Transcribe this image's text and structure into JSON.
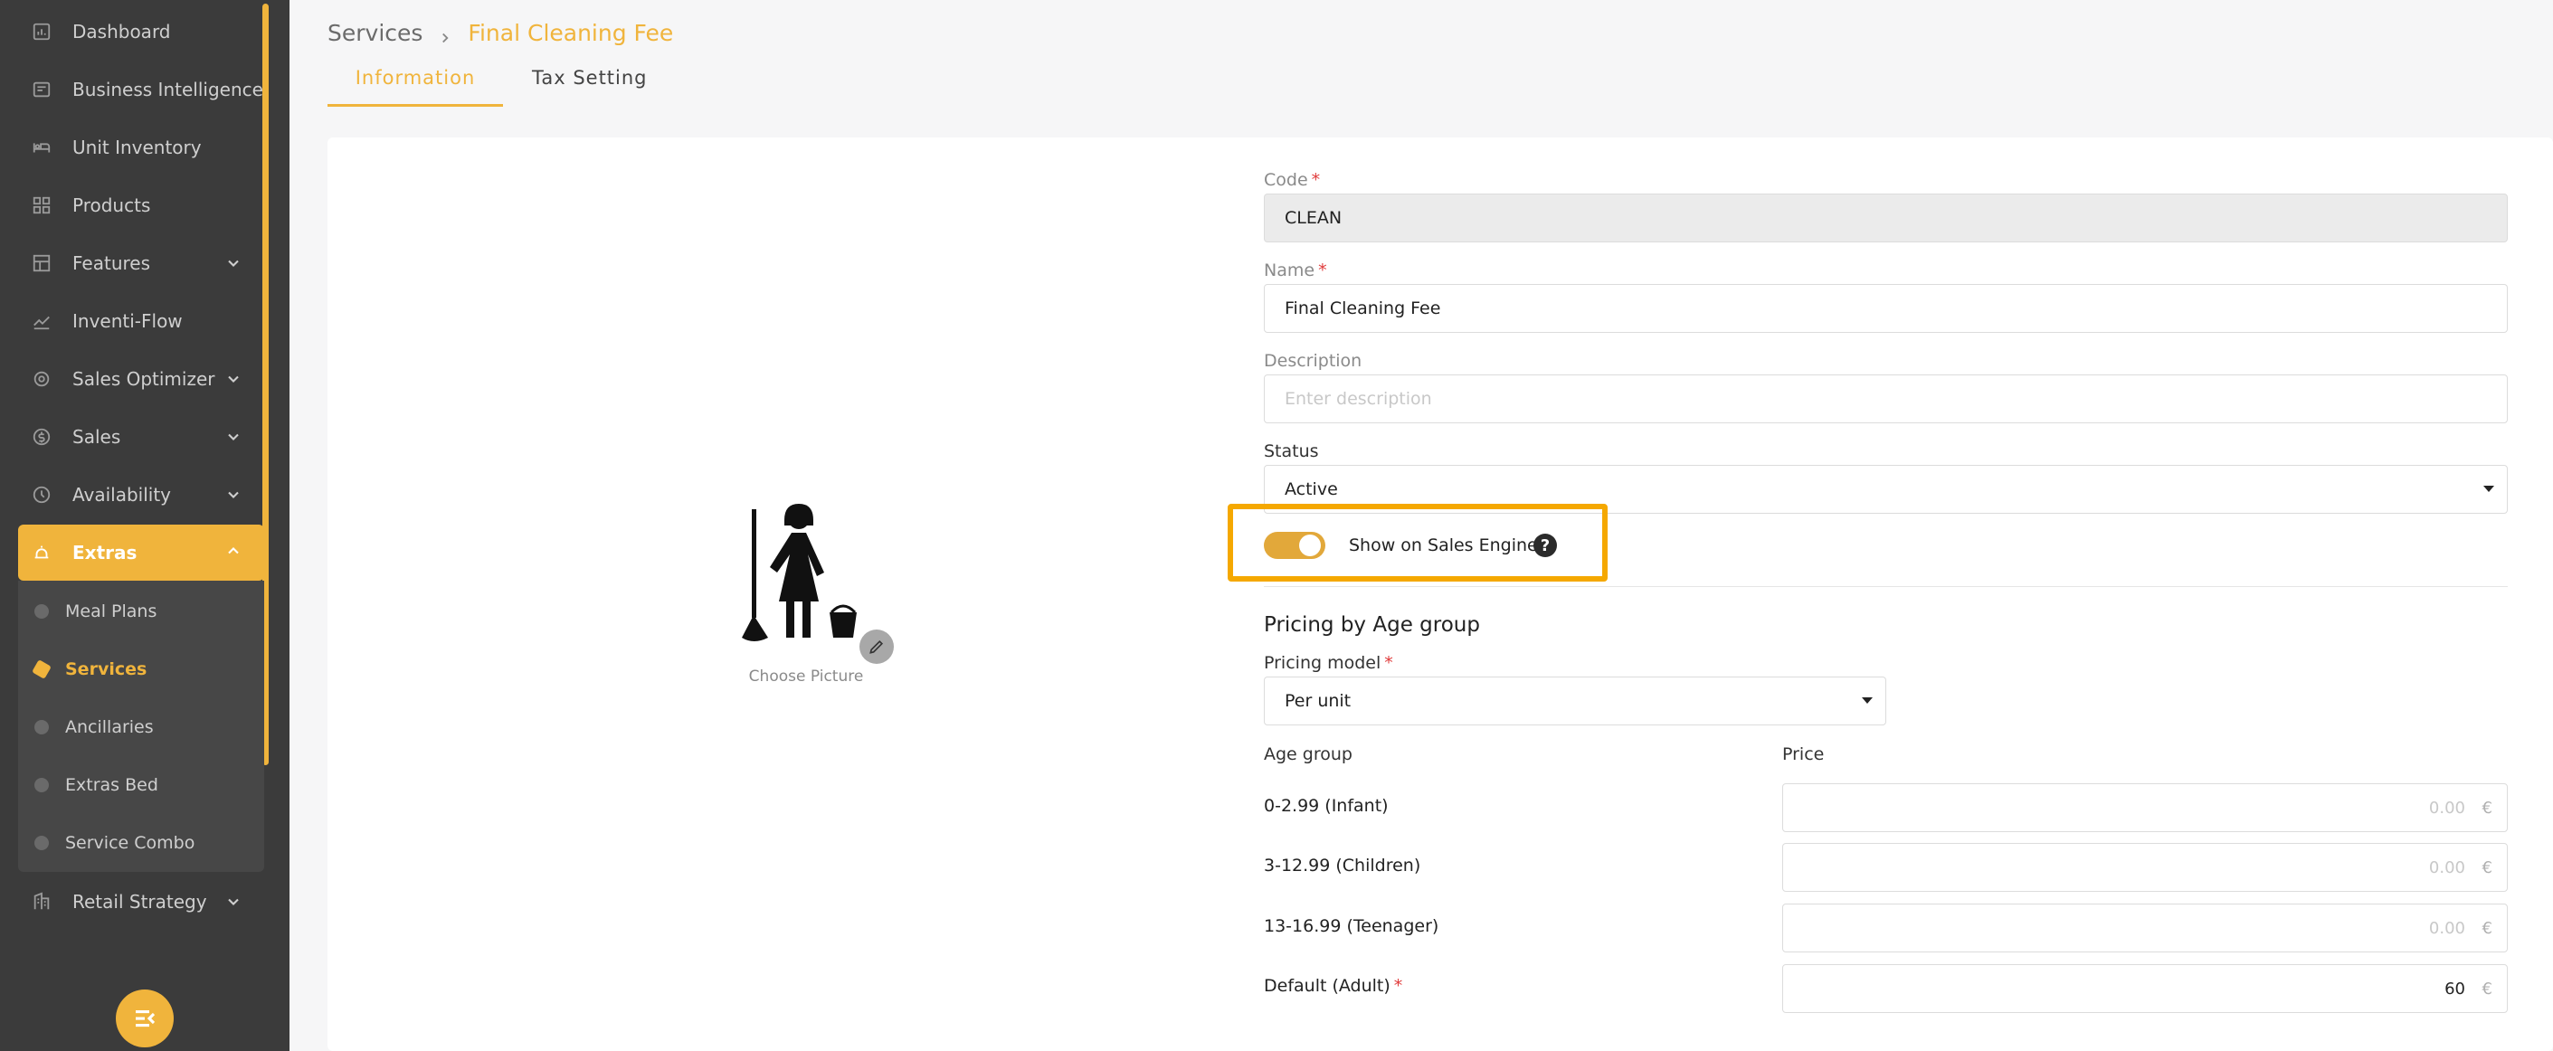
{
  "sidebar": {
    "items": [
      {
        "label": "Dashboard",
        "icon": "dashboard-icon"
      },
      {
        "label": "Business Intelligence",
        "icon": "chart-icon"
      },
      {
        "label": "Unit Inventory",
        "icon": "bed-icon"
      },
      {
        "label": "Products",
        "icon": "grid-icon"
      },
      {
        "label": "Features",
        "icon": "layout-icon"
      },
      {
        "label": "Inventi-Flow",
        "icon": "trend-icon"
      },
      {
        "label": "Sales Optimizer",
        "icon": "gear-icon"
      },
      {
        "label": "Sales",
        "icon": "dollar-icon"
      },
      {
        "label": "Availability",
        "icon": "clock-icon"
      },
      {
        "label": "Extras",
        "icon": "bell-icon"
      },
      {
        "label": "Retail Strategy",
        "icon": "building-icon"
      }
    ],
    "extras_sub": [
      "Meal Plans",
      "Services",
      "Ancillaries",
      "Extras Bed",
      "Service Combo"
    ],
    "active_sub": "Services"
  },
  "breadcrumb": {
    "root": "Services",
    "current": "Final Cleaning Fee"
  },
  "tabs": [
    "Information",
    "Tax Setting"
  ],
  "picture": {
    "label": "Choose Picture"
  },
  "form": {
    "code": {
      "label": "Code",
      "value": "CLEAN"
    },
    "name": {
      "label": "Name",
      "value": "Final Cleaning Fee"
    },
    "description": {
      "label": "Description",
      "placeholder": "Enter description"
    },
    "status": {
      "label": "Status",
      "value": "Active"
    },
    "show_on_sales_engine": {
      "label": "Show on Sales Engine",
      "on": true,
      "help": "?"
    }
  },
  "pricing": {
    "title": "Pricing by Age group",
    "model_label": "Pricing model",
    "model_value": "Per unit",
    "age_group_header": "Age group",
    "price_header": "Price",
    "currency": "€",
    "rows": [
      {
        "age": "0-2.99 (Infant)",
        "value": "0.00",
        "required": false
      },
      {
        "age": "3-12.99 (Children)",
        "value": "0.00",
        "required": false
      },
      {
        "age": "13-16.99 (Teenager)",
        "value": "0.00",
        "required": false
      },
      {
        "age": "Default (Adult)",
        "value": "60",
        "required": true
      }
    ]
  },
  "colors": {
    "accent": "#f0b43c",
    "sidebar": "#3b3b3b",
    "highlight": "#f5a800"
  }
}
